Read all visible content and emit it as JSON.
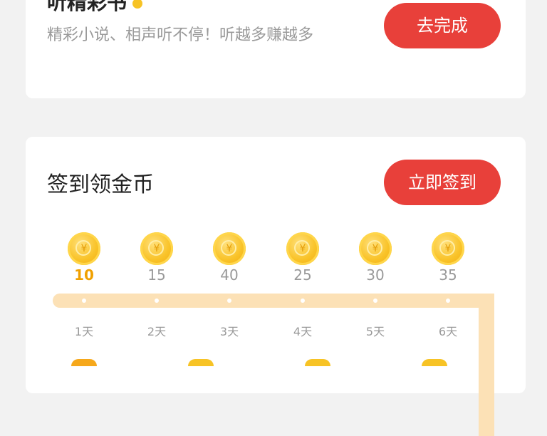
{
  "task": {
    "title": "听精彩书",
    "description": "精彩小说、相声听不停！听越多赚越多",
    "button_label": "去完成"
  },
  "signin": {
    "title": "签到领金币",
    "button_label": "立即签到",
    "coin_glyph": "¥",
    "days": [
      {
        "value": "10",
        "label": "1天"
      },
      {
        "value": "15",
        "label": "2天"
      },
      {
        "value": "40",
        "label": "3天"
      },
      {
        "value": "25",
        "label": "4天"
      },
      {
        "value": "30",
        "label": "5天"
      },
      {
        "value": "35",
        "label": "6天"
      }
    ]
  },
  "colors": {
    "accent": "#e8403a",
    "coin": "#f9c329",
    "track": "#fce1b6"
  }
}
